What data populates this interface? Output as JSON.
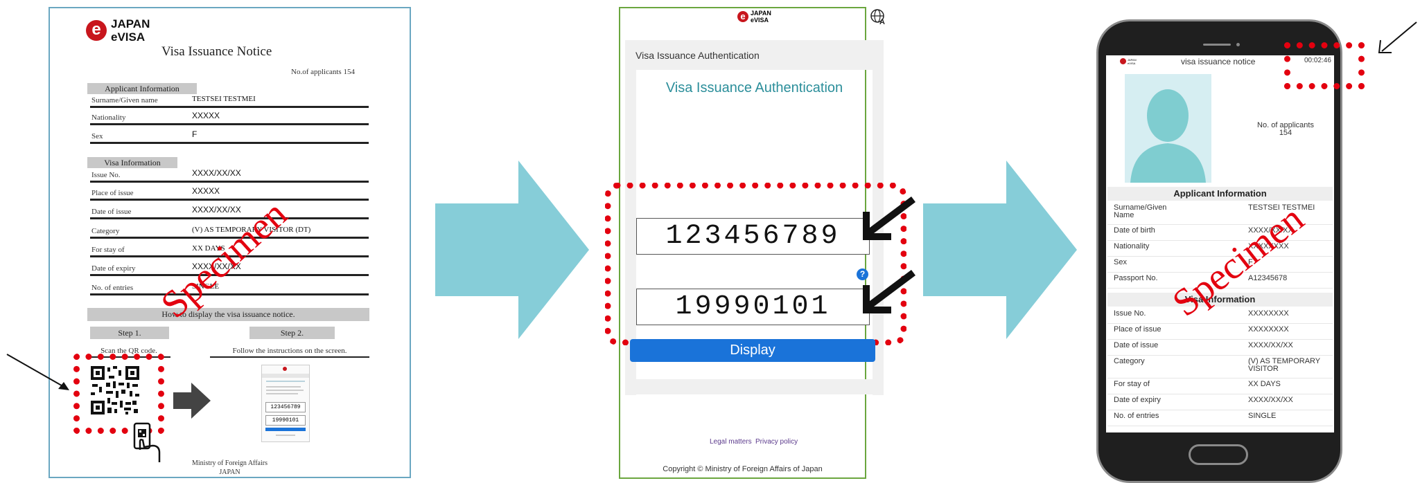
{
  "paper": {
    "logo_mark": "e",
    "logo_line1": "JAPAN",
    "logo_line2": "eVISA",
    "title": "Visa Issuance Notice",
    "applicants": "No.of applicants 154",
    "applicant_info_head": "Applicant Information",
    "visa_info_head": "Visa Information",
    "rows": [
      {
        "label": "Surname/Given name",
        "value": "TESTSEI TESTMEI"
      },
      {
        "label": "Nationality",
        "value": "XXXXX"
      },
      {
        "label": "Sex",
        "value": "F"
      },
      {
        "label": "Issue No.",
        "value": "XXXX/XX/XX"
      },
      {
        "label": "Place of issue",
        "value": "XXXXX"
      },
      {
        "label": "Date of issue",
        "value": "XXXX/XX/XX"
      },
      {
        "label": "Category",
        "value": "(V) AS TEMPORARY VISITOR (DT)"
      },
      {
        "label": "For stay of",
        "value": "XX DAYS"
      },
      {
        "label": "Date of expiry",
        "value": "XXXX/XX/XX"
      },
      {
        "label": "No. of entries",
        "value": "SINGLE"
      }
    ],
    "how_to": "How to display the visa issuance notice.",
    "step1": "Step 1.",
    "step2": "Step 2.",
    "step1_text": "Scan the QR code.",
    "step2_text": "Follow the instructions on the screen.",
    "mini_number": "123456789",
    "mini_date": "19990101",
    "footer1": "Ministry of Foreign Affairs",
    "footer2": "JAPAN",
    "specimen": "Specimen"
  },
  "auth": {
    "logo_line1": "JAPAN",
    "logo_line2": "eVISA",
    "language_icon": "globe-language-icon",
    "bar_title": "Visa Issuance Authentication",
    "heading": "Visa Issuance Authentication",
    "number_value": "123456789",
    "date_value": "19990101",
    "help_icon": "?",
    "display_label": "Display",
    "legal_link": "Legal matters",
    "privacy_link": "Privacy policy",
    "copyright": "Copyright © Ministry of Foreign Affairs of Japan"
  },
  "notice": {
    "title": "visa issuance notice",
    "timer": "00:02:46",
    "applicants_label": "No. of applicants",
    "applicants_count": "154",
    "applicant_head": "Applicant Information",
    "visa_head": "Visa Information",
    "rows_a": [
      {
        "label": "Surname/Given Name",
        "value": "TESTSEI TESTMEI"
      },
      {
        "label": "Date of birth",
        "value": "XXXX/XX/XX"
      },
      {
        "label": "Nationality",
        "value": "XXXXXXXX"
      },
      {
        "label": "Sex",
        "value": "F"
      },
      {
        "label": "Passport No.",
        "value": "A12345678"
      }
    ],
    "rows_b": [
      {
        "label": "Issue No.",
        "value": "XXXXXXXX"
      },
      {
        "label": "Place of issue",
        "value": "XXXXXXXX"
      },
      {
        "label": "Date of issue",
        "value": "XXXX/XX/XX"
      },
      {
        "label": "Category",
        "value": "(V) AS TEMPORARY VISITOR"
      },
      {
        "label": "For stay of",
        "value": "XX DAYS"
      },
      {
        "label": "Date of expiry",
        "value": "XXXX/XX/XX"
      },
      {
        "label": "No. of entries",
        "value": "SINGLE"
      }
    ],
    "specimen": "Specimen"
  },
  "colors": {
    "flow_arrow": "#86cdd8",
    "highlight": "#e3000f",
    "display_button": "#1a73d9",
    "heading_teal": "#2b8e9a"
  }
}
